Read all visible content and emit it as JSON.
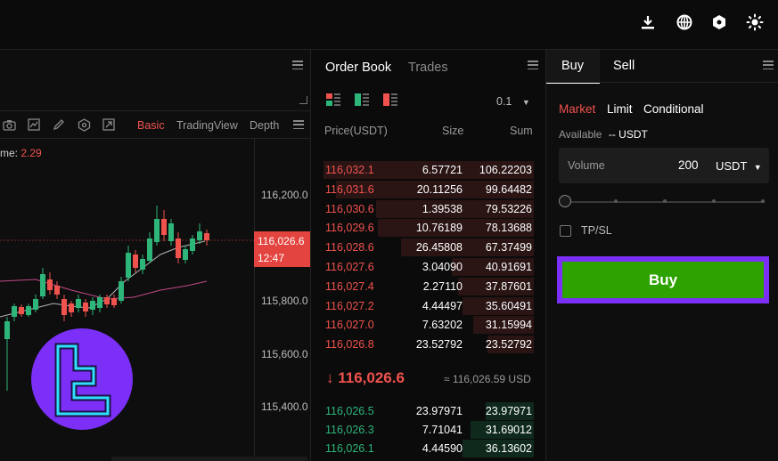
{
  "topbar": {
    "icons": [
      "download-icon",
      "globe-icon",
      "hexagon-icon",
      "settings-icon"
    ]
  },
  "chart": {
    "volume_label": "me:",
    "volume_value": "2.29",
    "tabs": [
      "Basic",
      "TradingView",
      "Depth"
    ],
    "active_tab": "Basic",
    "y_ticks": [
      "116,200.0",
      "115,800.0",
      "115,600.0",
      "115,400.0"
    ],
    "price_tag": "116,026.6",
    "price_time": "12:47",
    "accent": "#f0524d"
  },
  "orderbook": {
    "tab_orderbook": "Order Book",
    "tab_trades": "Trades",
    "precision": "0.1",
    "col_price": "Price(USDT)",
    "col_size": "Size",
    "col_sum": "Sum",
    "asks": [
      {
        "price": "116,032.1",
        "size": "6.57721",
        "sum": "106.22203",
        "depth": 1.0
      },
      {
        "price": "116,031.6",
        "size": "20.11256",
        "sum": "99.64482",
        "depth": 0.94
      },
      {
        "price": "116,030.6",
        "size": "1.39538",
        "sum": "79.53226",
        "depth": 0.75
      },
      {
        "price": "116,029.6",
        "size": "10.76189",
        "sum": "78.13688",
        "depth": 0.74
      },
      {
        "price": "116,028.6",
        "size": "26.45808",
        "sum": "67.37499",
        "depth": 0.63
      },
      {
        "price": "116,027.6",
        "size": "3.04090",
        "sum": "40.91691",
        "depth": 0.39
      },
      {
        "price": "116,027.4",
        "size": "2.27110",
        "sum": "37.87601",
        "depth": 0.36
      },
      {
        "price": "116,027.2",
        "size": "4.44497",
        "sum": "35.60491",
        "depth": 0.34
      },
      {
        "price": "116,027.0",
        "size": "7.63202",
        "sum": "31.15994",
        "depth": 0.29
      },
      {
        "price": "116,026.8",
        "size": "23.52792",
        "sum": "23.52792",
        "depth": 0.22
      }
    ],
    "last_price": "↓ 116,026.6",
    "last_price_usd": "≈ 116,026.59 USD",
    "bids": [
      {
        "price": "116,026.5",
        "size": "23.97971",
        "sum": "23.97971",
        "depth": 0.23
      },
      {
        "price": "116,026.3",
        "size": "7.71041",
        "sum": "31.69012",
        "depth": 0.3
      },
      {
        "price": "116,026.1",
        "size": "4.44590",
        "sum": "36.13602",
        "depth": 0.34
      }
    ],
    "ask_color": "#f0524d",
    "bid_color": "#2eb57a"
  },
  "trade": {
    "tab_buy": "Buy",
    "tab_sell": "Sell",
    "order_types": [
      "Market",
      "Limit",
      "Conditional"
    ],
    "active_order_type": "Market",
    "available_label": "Available",
    "available_value": "-- USDT",
    "volume_label": "Volume",
    "volume_value": "200",
    "volume_unit": "USDT",
    "tpsl_label": "TP/SL",
    "buy_button": "Buy",
    "buy_color": "#2ea200",
    "highlight_color": "#7b2ff7"
  }
}
